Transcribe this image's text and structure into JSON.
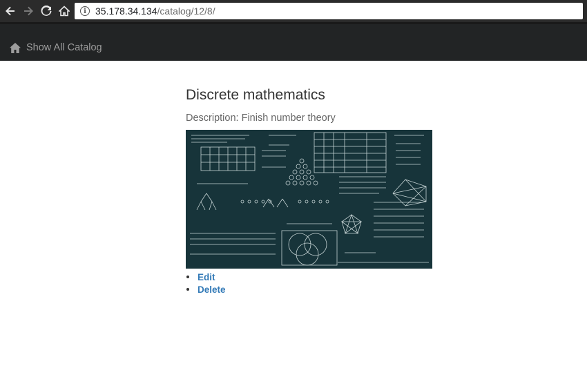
{
  "browser": {
    "url_host": "35.178.34.134",
    "url_path": "/catalog/12/8/"
  },
  "navbar": {
    "brand_label": "Show All Catalog"
  },
  "item": {
    "title": "Discrete mathematics",
    "description": "Description: Finish number theory",
    "image_alt": "chalkboard of discrete mathematics formulas"
  },
  "actions": [
    {
      "label": "Edit"
    },
    {
      "label": "Delete"
    }
  ]
}
